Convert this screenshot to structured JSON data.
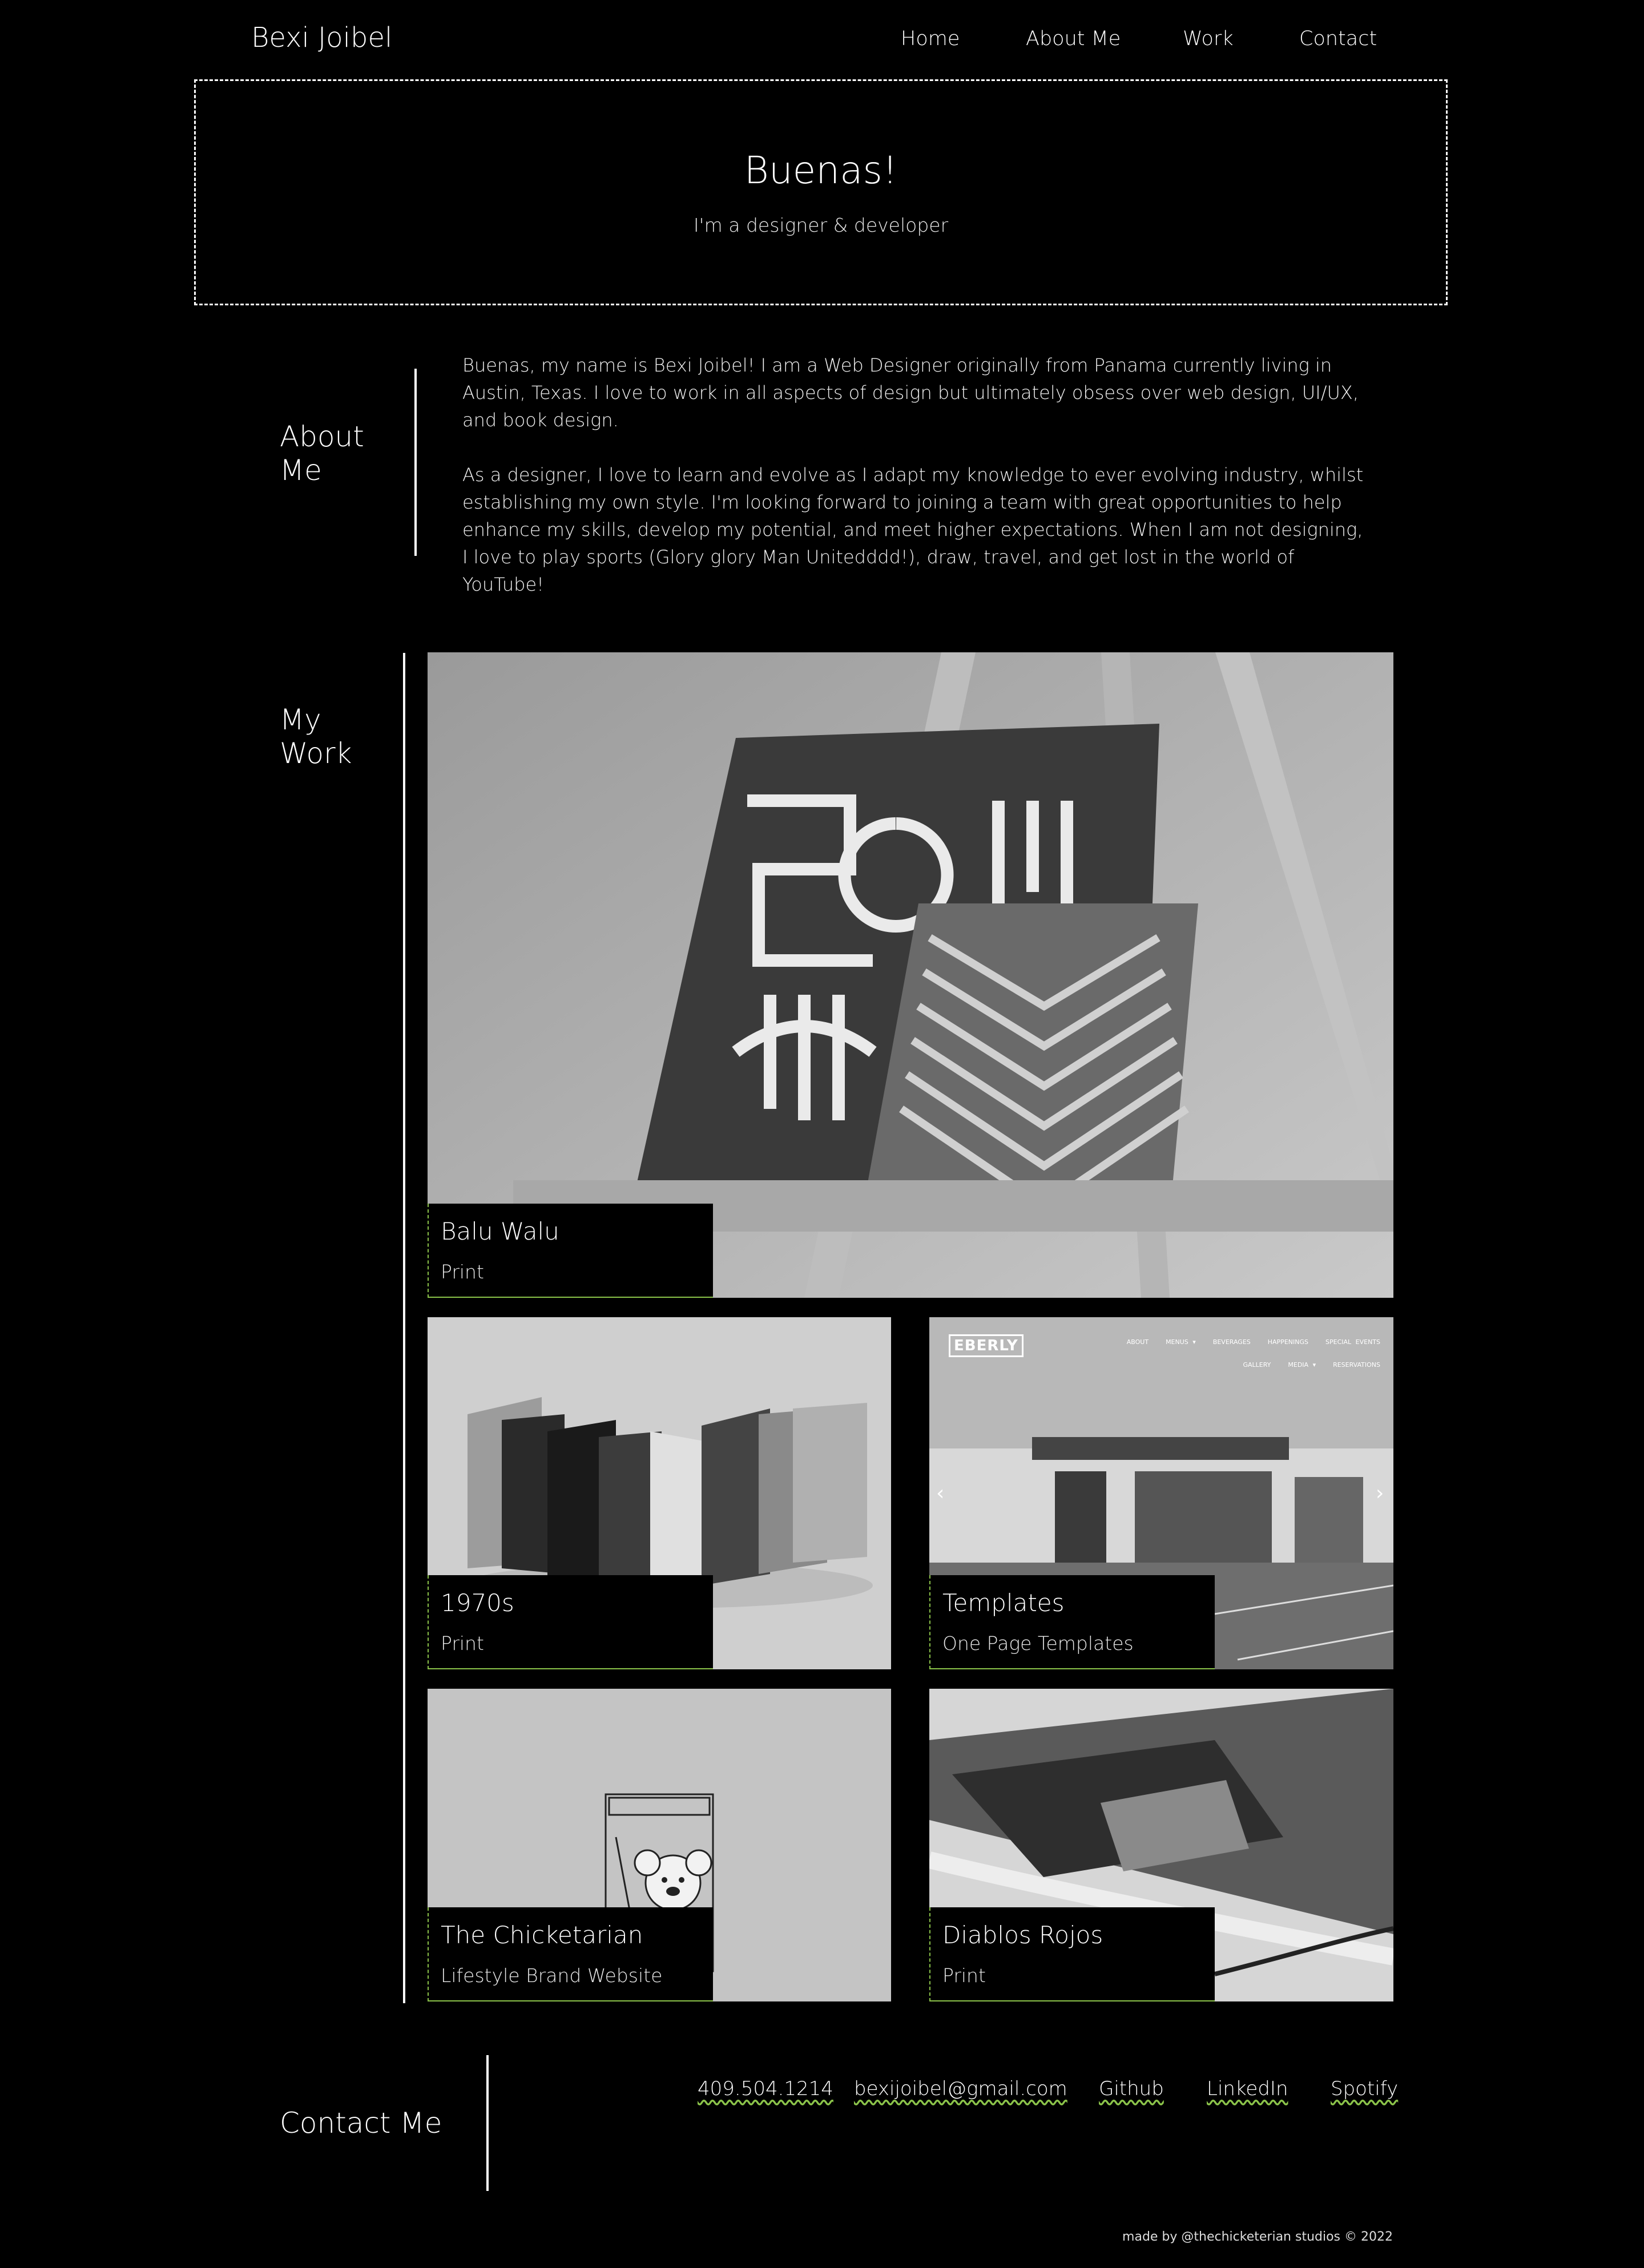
{
  "header": {
    "brand": "Bexi Joibel",
    "nav": [
      {
        "label": "Home"
      },
      {
        "label": "About Me"
      },
      {
        "label": "Work"
      },
      {
        "label": "Contact"
      }
    ]
  },
  "hero": {
    "title": "Buenas!",
    "subtitle": "I'm a designer & developer"
  },
  "about": {
    "heading_line1": "About",
    "heading_line2": "Me",
    "paragraphs": [
      "Buenas, my name is Bexi Joibel! I am a Web Designer originally from Panama currently living in Austin, Texas. I love to work in all aspects of design but ultimately obsess over web design, UI/UX, and book design.",
      "As a designer, I love to learn and evolve as I adapt my knowledge to ever evolving industry, whilst establishing my own style. I'm looking forward to joining a team with great opportunities to help enhance my skills, develop my potential, and meet higher expectations. When I am not designing, I love to play sports (Glory glory Man Unitedddd!), draw, travel, and get lost in the world of YouTube!"
    ]
  },
  "work": {
    "heading_line1": "My",
    "heading_line2": "Work",
    "projects": [
      {
        "title": "Balu Walu",
        "category": "Print"
      },
      {
        "title": "1970s",
        "category": "Print"
      },
      {
        "title": "Templates",
        "category": "One Page Templates",
        "preview": {
          "logo": "EBERLY",
          "menu": [
            "ABOUT",
            "MENUS ▾",
            "BEVERAGES",
            "HAPPENINGS",
            "SPECIAL EVENTS",
            "GALLERY",
            "MEDIA ▾",
            "RESERVATIONS"
          ]
        }
      },
      {
        "title": "The Chicketarian",
        "category": "Lifestyle Brand Website"
      },
      {
        "title": "Diablos Rojos",
        "category": "Print"
      }
    ]
  },
  "contact": {
    "heading": "Contact Me",
    "links": [
      {
        "label": "409.504.1214"
      },
      {
        "label": "bexijoibel@gmail.com"
      },
      {
        "label": "Github"
      },
      {
        "label": "LinkedIn"
      },
      {
        "label": "Spotify"
      }
    ]
  },
  "footer": {
    "credit": "made by @thechicketerian studios © 2022"
  },
  "colors": {
    "background": "#000000",
    "text": "#ffffff",
    "accent": "#8bc34a"
  },
  "icons": [
    "chevron-left-icon",
    "chevron-right-icon"
  ]
}
